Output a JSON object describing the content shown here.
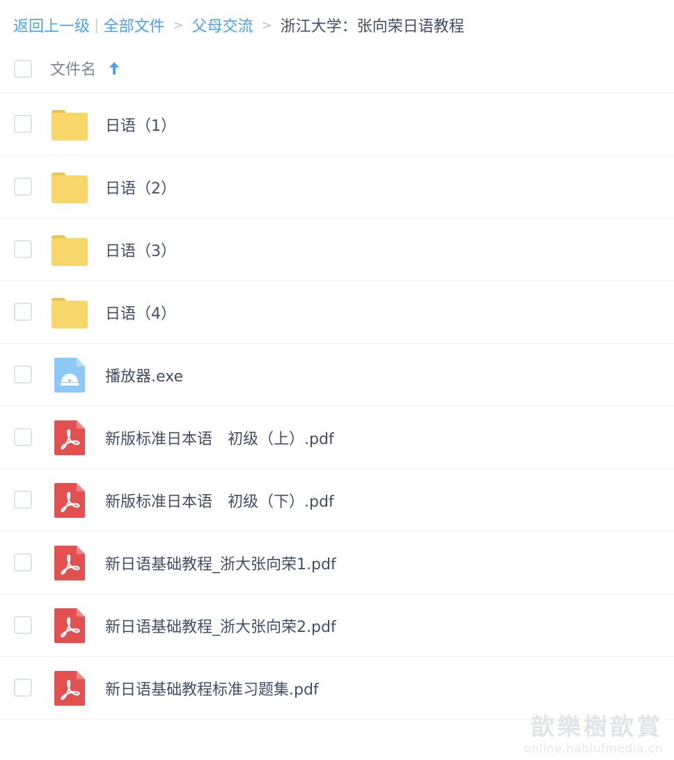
{
  "breadcrumb": {
    "back": "返回上一级",
    "separator_pipe": "|",
    "all_files": "全部文件",
    "arrow": ">",
    "parent": "父母交流",
    "current": "浙江大学：张向荣日语教程"
  },
  "header": {
    "column_label": "文件名",
    "sort_icon": "arrow-up-icon",
    "sort_color": "#4a9ff5"
  },
  "colors": {
    "link": "#4a9ff5",
    "text": "#424e67",
    "folder": "#f7d66a",
    "pdf": "#e35050",
    "exe": "#8cc9f7"
  },
  "files": [
    {
      "name": "日语（1）",
      "icon": "folder-icon",
      "type": "folder"
    },
    {
      "name": "日语（2）",
      "icon": "folder-icon",
      "type": "folder"
    },
    {
      "name": "日语（3）",
      "icon": "folder-icon",
      "type": "folder"
    },
    {
      "name": "日语（4）",
      "icon": "folder-icon",
      "type": "folder"
    },
    {
      "name": "播放器.exe",
      "icon": "exe-file-icon",
      "type": "exe"
    },
    {
      "name": "新版标准日本语　初级（上）.pdf",
      "icon": "pdf-file-icon",
      "type": "pdf"
    },
    {
      "name": "新版标准日本语　初级（下）.pdf",
      "icon": "pdf-file-icon",
      "type": "pdf"
    },
    {
      "name": "新日语基础教程_浙大张向荣1.pdf",
      "icon": "pdf-file-icon",
      "type": "pdf"
    },
    {
      "name": "新日语基础教程_浙大张向荣2.pdf",
      "icon": "pdf-file-icon",
      "type": "pdf"
    },
    {
      "name": "新日语基础教程标准习题集.pdf",
      "icon": "pdf-file-icon",
      "type": "pdf"
    }
  ],
  "watermark": {
    "title": "歆樂樹歆賞",
    "url": "online.hablufmedia.cn"
  }
}
